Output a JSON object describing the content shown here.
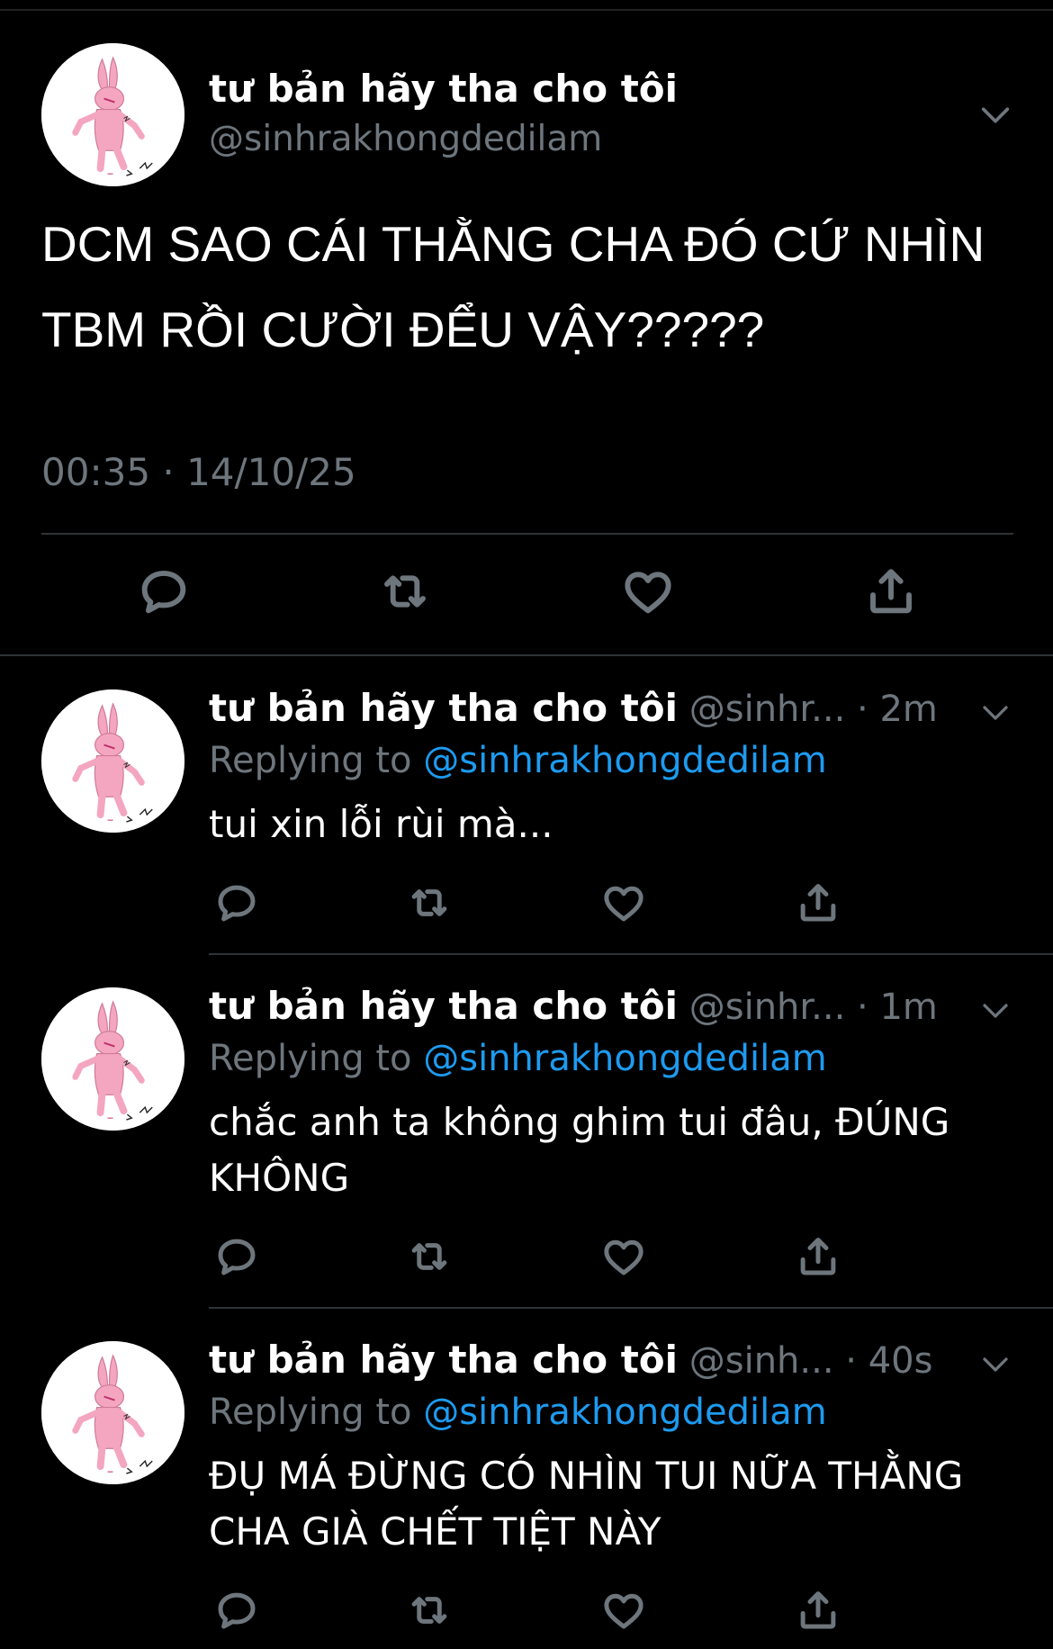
{
  "main_tweet": {
    "display_name": "tư bản hãy tha cho tôi",
    "handle": "@sinhrakhongdedilam",
    "text": "DCM SAO CÁI THẰNG CHA ĐÓ CỨ NHÌN TBM RỒI CƯỜI ĐỂU VẬY?????",
    "timestamp": "00:35 · 14/10/25"
  },
  "replies": [
    {
      "display_name": "tư bản hãy tha cho tôi",
      "meta": " @sinhr... · 2m",
      "replying_prefix": "Replying to ",
      "replying_to": "@sinhrakhongdedilam",
      "text": "tui xin lỗi rùi mà..."
    },
    {
      "display_name": "tư bản hãy tha cho tôi",
      "meta": " @sinhr...  · 1m",
      "replying_prefix": "Replying to ",
      "replying_to": "@sinhrakhongdedilam",
      "text": "chắc anh ta không ghim tui đâu, ĐÚNG KHÔNG"
    },
    {
      "display_name": "tư bản hãy tha cho tôi",
      "meta": " @sinh... · 40s",
      "replying_prefix": "Replying to ",
      "replying_to": "@sinhrakhongdedilam",
      "text": "ĐỤ MÁ ĐỪNG CÓ NHÌN TUI NỮA THẰNG CHA GIÀ CHẾT TIỆT NÀY"
    }
  ],
  "icons": [
    "reply-icon",
    "retweet-icon",
    "like-icon",
    "share-icon",
    "chevron-down-icon",
    "avatar-bunny"
  ],
  "colors": {
    "background": "#000000",
    "text_primary": "#ffffff",
    "text_secondary": "#6e767d",
    "link": "#1d9bf0",
    "divider": "#2f3336",
    "avatar_bunny": "#f4a6c0"
  }
}
